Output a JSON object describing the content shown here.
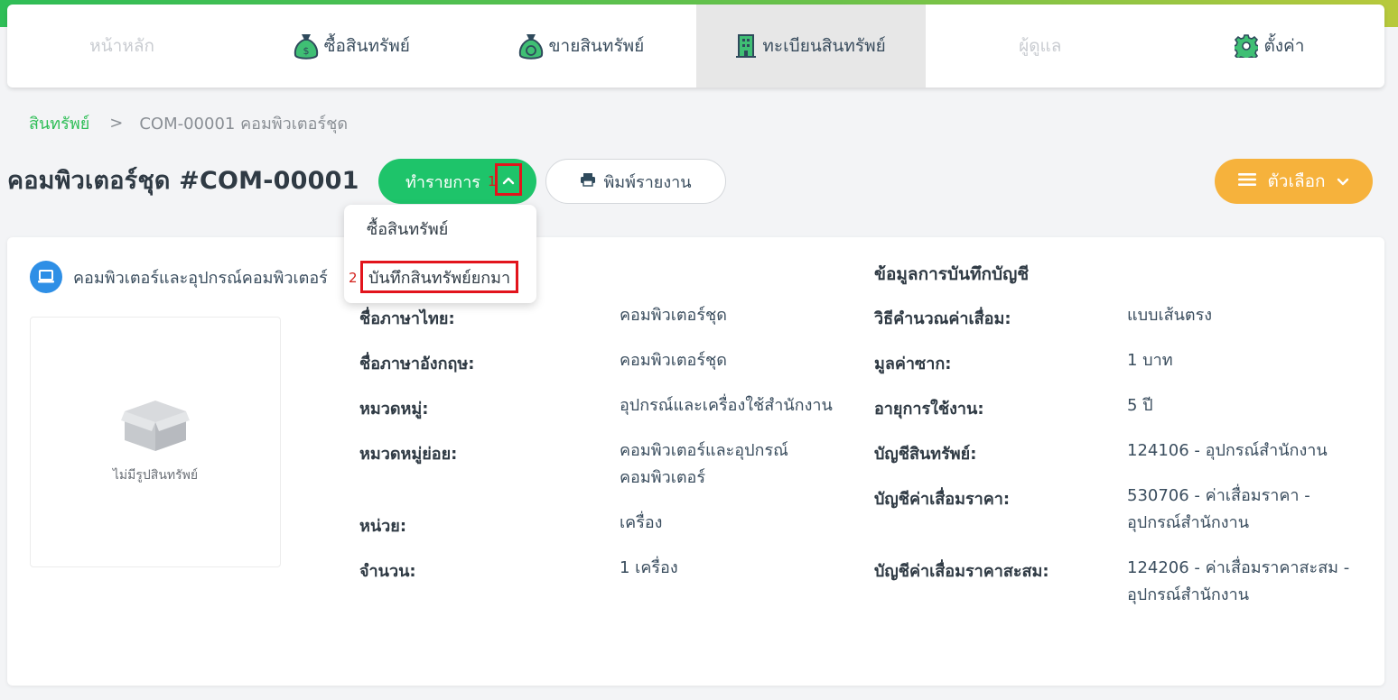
{
  "nav": {
    "items": [
      {
        "label": "หน้าหลัก",
        "icon": "home"
      },
      {
        "label": "ซื้อสินทรัพย์",
        "icon": "money-bag-icon"
      },
      {
        "label": "ขายสินทรัพย์",
        "icon": "money-bag-icon"
      },
      {
        "label": "ทะเบียนสินทรัพย์",
        "icon": "building-icon"
      },
      {
        "label": "ผู้ดูแล",
        "icon": "user"
      },
      {
        "label": "ตั้งค่า",
        "icon": "gear-icon"
      }
    ],
    "active_index": 3
  },
  "breadcrumb": {
    "root": "สินทรัพย์",
    "separator": ">",
    "current": "COM-00001 คอมพิวเตอร์ชุด"
  },
  "page": {
    "title": "คอมพิวเตอร์ชุด #COM-00001"
  },
  "toolbar": {
    "action_label": "ทำรายการ",
    "action_marker": "1",
    "print_label": "พิมพ์รายงาน",
    "options_label": "ตัวเลือก"
  },
  "dropdown": {
    "items": [
      "ซื้อสินทรัพย์",
      "บันทึกสินทรัพย์ยกมา"
    ],
    "marker": "2"
  },
  "asset": {
    "category_line": "คอมพิวเตอร์และอุปกรณ์คอมพิวเตอร์",
    "no_image_text": "ไม่มีรูปสินทรัพย์"
  },
  "details": {
    "rows": [
      {
        "label": "ชื่อภาษาไทย:",
        "value": "คอมพิวเตอร์ชุด"
      },
      {
        "label": "ชื่อภาษาอังกฤษ:",
        "value": "คอมพิวเตอร์ชุด"
      },
      {
        "label": "หมวดหมู่:",
        "value": "อุปกรณ์และเครื่องใช้สำนักงาน"
      },
      {
        "label": "หมวดหมู่ย่อย:",
        "value_lines": [
          "คอมพิวเตอร์และอุปกรณ์",
          "คอมพิวเตอร์"
        ]
      },
      {
        "label": "หน่วย:",
        "value": "เครื่อง"
      },
      {
        "label": "จำนวน:",
        "value": "1 เครื่อง"
      }
    ]
  },
  "accounting": {
    "title": "ข้อมูลการบันทึกบัญชี",
    "rows": [
      {
        "label": "วิธีคำนวณค่าเสื่อม:",
        "value": "แบบเส้นตรง"
      },
      {
        "label": "มูลค่าซาก:",
        "value": "1 บาท"
      },
      {
        "label": "อายุการใช้งาน:",
        "value": "5 ปี"
      },
      {
        "label": "บัญชีสินทรัพย์:",
        "value": "124106 - อุปกรณ์สำนักงาน"
      },
      {
        "label": "บัญชีค่าเสื่อมราคา:",
        "value_lines": [
          "530706 - ค่าเสื่อมราคา -",
          "อุปกรณ์สำนักงาน"
        ]
      },
      {
        "label": "บัญชีค่าเสื่อมราคาสะสม:",
        "value_lines": [
          "124206 - ค่าเสื่อมราคาสะสม -",
          "อุปกรณ์สำนักงาน"
        ]
      }
    ]
  },
  "colors": {
    "brand_green": "#1ec46a",
    "options_orange": "#f6b23c",
    "highlight_red": "#e2141c",
    "info_blue": "#2e8fe6"
  }
}
